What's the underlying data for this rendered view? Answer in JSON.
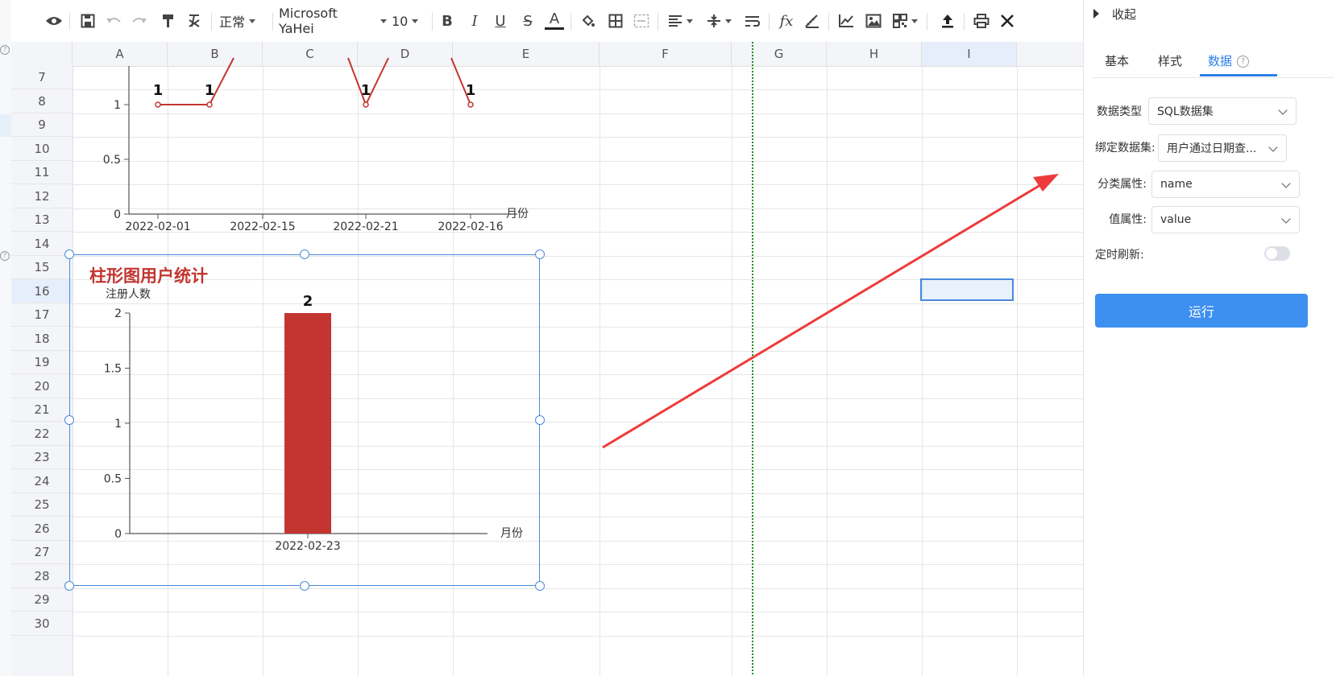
{
  "toolbar": {
    "style_label": "正常",
    "font_family": "Microsoft YaHei",
    "font_size": "10"
  },
  "grid": {
    "columns": [
      "A",
      "B",
      "C",
      "D",
      "E",
      "F",
      "G",
      "H",
      "I"
    ],
    "rows": [
      "7",
      "8",
      "9",
      "10",
      "11",
      "12",
      "13",
      "14",
      "15",
      "16",
      "17",
      "18",
      "19",
      "20",
      "21",
      "22",
      "23",
      "24",
      "25",
      "26",
      "27",
      "28",
      "29",
      "30"
    ],
    "active_column": "I",
    "active_row": "16"
  },
  "line_chart": {
    "xlabel": "月份",
    "y_ticks": [
      "0",
      "0.5",
      "1"
    ],
    "x_ticks": [
      "2022-02-01",
      "2022-02-15",
      "2022-02-21",
      "2022-02-16"
    ],
    "data_labels": [
      "1",
      "1",
      "1",
      "1"
    ]
  },
  "bar_chart_widget": {
    "title": "柱形图用户统计",
    "ylabel": "注册人数",
    "xlabel": "月份"
  },
  "chart_data": [
    {
      "type": "line",
      "x": [
        "2022-02-01",
        "2022-02-15",
        "2022-02-21",
        "2022-02-16"
      ],
      "values": [
        1,
        1,
        1,
        1
      ],
      "xlabel": "月份",
      "ylabel": "",
      "ylim": [
        0,
        1
      ],
      "color": "#c23531"
    },
    {
      "type": "bar",
      "title": "柱形图用户统计",
      "categories": [
        "2022-02-23"
      ],
      "values": [
        2
      ],
      "xlabel": "月份",
      "ylabel": "注册人数",
      "ylim": [
        0,
        2
      ],
      "y_ticks": [
        0,
        0.5,
        1,
        1.5,
        2
      ],
      "color": "#c23531"
    }
  ],
  "panel": {
    "collapse_label": "收起",
    "tabs": [
      {
        "label": "基本"
      },
      {
        "label": "样式"
      },
      {
        "label": "数据"
      }
    ],
    "help_glyph": "?",
    "active_tab": "数据",
    "fields": {
      "data_type_label": "数据类型",
      "data_type_value": "SQL数据集",
      "dataset_label": "绑定数据集:",
      "dataset_value": "用户通过日期查...",
      "category_label": "分类属性:",
      "category_value": "name",
      "value_label": "值属性:",
      "value_value": "value",
      "refresh_label": "定时刷新:"
    },
    "refresh_enabled": false,
    "run_label": "运行"
  },
  "colors": {
    "accent": "#2f7fe6",
    "chart_red": "#c23531",
    "selection_blue": "#4a89dc",
    "annotation_arrow": "#ee3b3b"
  }
}
